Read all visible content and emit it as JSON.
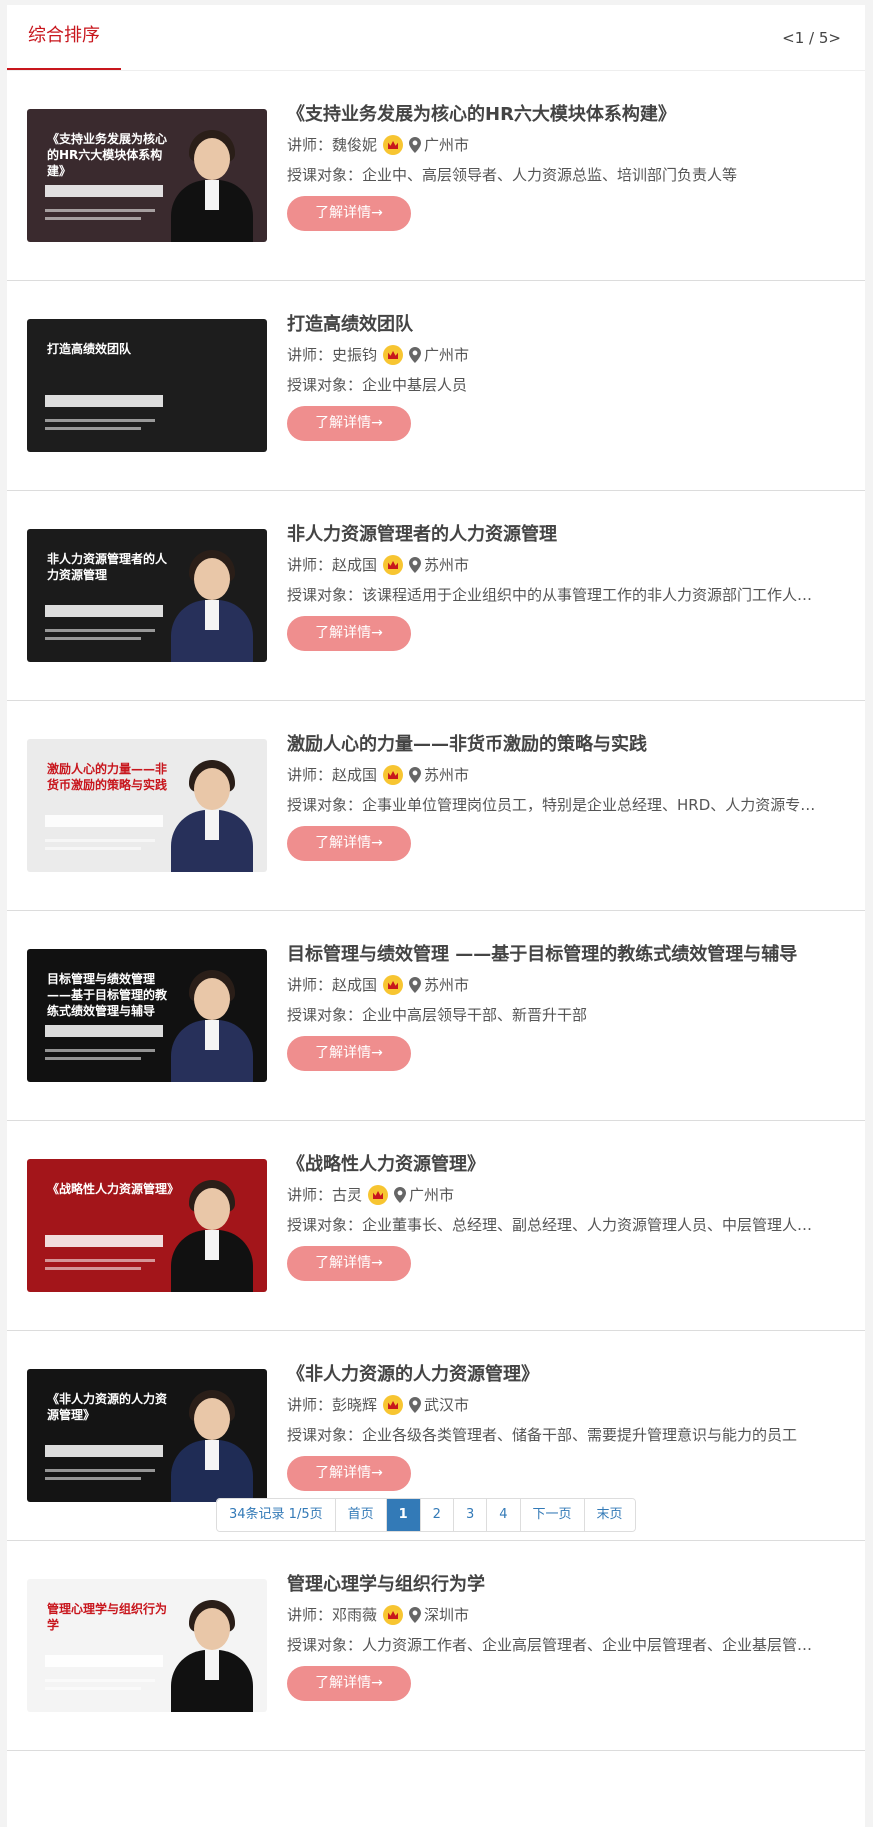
{
  "tabs": {
    "active_label": "综合排序",
    "page_indicator": "<1 / 5>"
  },
  "detail_label": "了解详情→",
  "lecturer_prefix": "讲师：",
  "target_prefix": "授课对象：",
  "courses": [
    {
      "title": "《支持业务发展为核心的HR六大模块体系构建》",
      "lecturer": "魏俊妮",
      "city": "广州市",
      "target": "企业中、高层领导者、人力资源总监、培训部门负责人等",
      "thumb_text": "《支持业务发展为核心的HR六大模块体系构建》",
      "thumb_bg": "#3a2a2e",
      "person_color": "#111111"
    },
    {
      "title": "打造高绩效团队",
      "lecturer": "史振钧",
      "city": "广州市",
      "target": "企业中基层人员",
      "thumb_text": "打造高绩效团队",
      "thumb_bg": "#1d1d1d",
      "person_color": ""
    },
    {
      "title": "非人力资源管理者的人力资源管理",
      "lecturer": "赵成国",
      "city": "苏州市",
      "target": "该课程适用于企业组织中的从事管理工作的非人力资源部门工作人员以及人力资源工作者",
      "thumb_text": "非人力资源管理者的人力资源管理",
      "thumb_bg": "#1b1b1b",
      "person_color": "#27305a"
    },
    {
      "title": "激励人心的力量——非货币激励的策略与实践",
      "lecturer": "赵成国",
      "city": "苏州市",
      "target": "企事业单位管理岗位员工，特别是企业总经理、HRD、人力资源专业人士",
      "thumb_text": "激励人心的力量——非货币激励的策略与实践",
      "thumb_bg": "#ebebeb",
      "person_color": "#27305a"
    },
    {
      "title": "目标管理与绩效管理 ——基于目标管理的教练式绩效管理与辅导",
      "lecturer": "赵成国",
      "city": "苏州市",
      "target": "企业中高层领导干部、新晋升干部",
      "thumb_text": "目标管理与绩效管理——基于目标管理的教练式绩效管理与辅导",
      "thumb_bg": "#111111",
      "person_color": "#27305a"
    },
    {
      "title": "《战略性人力资源管理》",
      "lecturer": "古灵",
      "city": "广州市",
      "target": "企业董事长、总经理、副总经理、人力资源管理人员、中层管理人员及骨干等核心人才",
      "thumb_text": "《战略性人力资源管理》",
      "thumb_bg": "#a3151a",
      "person_color": "#111111"
    },
    {
      "title": "《非人力资源的人力资源管理》",
      "lecturer": "彭晓辉",
      "city": "武汉市",
      "target": "企业各级各类管理者、储备干部、需要提升管理意识与能力的员工",
      "thumb_text": "《非人力资源的人力资源管理》",
      "thumb_bg": "#141414",
      "person_color": "#1f2c55"
    },
    {
      "title": "管理心理学与组织行为学",
      "lecturer": "邓雨薇",
      "city": "深圳市",
      "target": "人力资源工作者、企业高层管理者、企业中层管理者、企业基层管理者",
      "thumb_text": "管理心理学与组织行为学",
      "thumb_bg": "#f4f4f4",
      "person_color": "#111111"
    }
  ],
  "pagination": {
    "summary": "34条记录 1/5页",
    "first": "首页",
    "pages": [
      "1",
      "2",
      "3",
      "4"
    ],
    "next": "下一页",
    "last": "末页"
  }
}
